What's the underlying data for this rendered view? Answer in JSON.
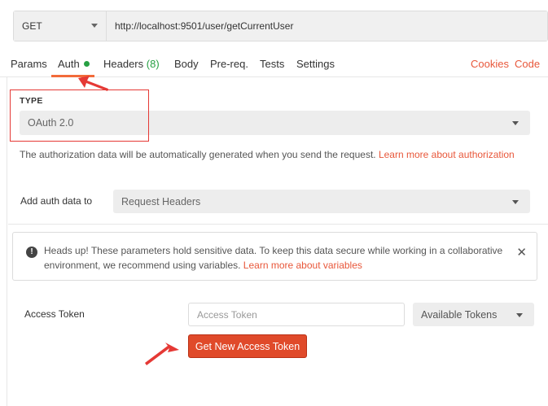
{
  "request": {
    "method": "GET",
    "url": "http://localhost:9501/user/getCurrentUser"
  },
  "tabs": {
    "items": [
      {
        "label": "Params"
      },
      {
        "label": "Auth",
        "indicator": "green-dot"
      },
      {
        "label": "Headers",
        "count": "(8)"
      },
      {
        "label": "Body"
      },
      {
        "label": "Pre-req."
      },
      {
        "label": "Tests"
      },
      {
        "label": "Settings"
      }
    ],
    "active": "Auth",
    "right_links": [
      "Cookies",
      "Code"
    ]
  },
  "auth": {
    "type_heading": "TYPE",
    "type_value": "OAuth 2.0",
    "description": "The authorization data will be automatically generated when you send the request.",
    "learn_more_link": "Learn more about authorization",
    "add_auth_label": "Add auth data to",
    "add_auth_value": "Request Headers"
  },
  "notice": {
    "text": "Heads up! These parameters hold sensitive data. To keep this data secure while working in a collaborative environment, we recommend using variables.",
    "link": "Learn more about variables",
    "icon": "warning-icon",
    "close_icon": "close-icon"
  },
  "token": {
    "label": "Access Token",
    "placeholder": "Access Token",
    "dropdown_value": "Available Tokens",
    "button_label": "Get New Access Token"
  },
  "colors": {
    "accent": "#e04a2a",
    "link": "#e8573a",
    "status_green": "#27a043",
    "annotation_red": "#e53935"
  }
}
